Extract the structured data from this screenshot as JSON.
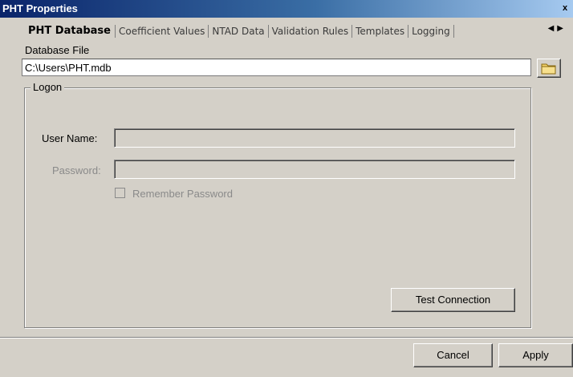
{
  "window": {
    "title": "PHT Properties",
    "close_glyph": "x"
  },
  "tabs": [
    {
      "label": "PHT Database",
      "active": true
    },
    {
      "label": "Coefficient Values"
    },
    {
      "label": "NTAD Data"
    },
    {
      "label": "Validation Rules"
    },
    {
      "label": "Templates"
    },
    {
      "label": "Logging"
    }
  ],
  "tab_scroll": {
    "left_glyph": "◀",
    "right_glyph": "▶"
  },
  "database": {
    "label": "Database File",
    "path": "C:\\Users\\PHT.mdb",
    "browse_icon": "folder-icon"
  },
  "logon": {
    "legend": "Logon",
    "username_label": "User Name:",
    "username_value": "",
    "password_label": "Password:",
    "password_value": "",
    "remember_label": "Remember Password",
    "remember_checked": false,
    "test_button": "Test Connection"
  },
  "footer": {
    "cancel": "Cancel",
    "apply": "Apply"
  },
  "colors": {
    "dialog_bg": "#d4d0c8",
    "titlebar": "#0a246a",
    "disabled_text": "#8a8a8a"
  }
}
